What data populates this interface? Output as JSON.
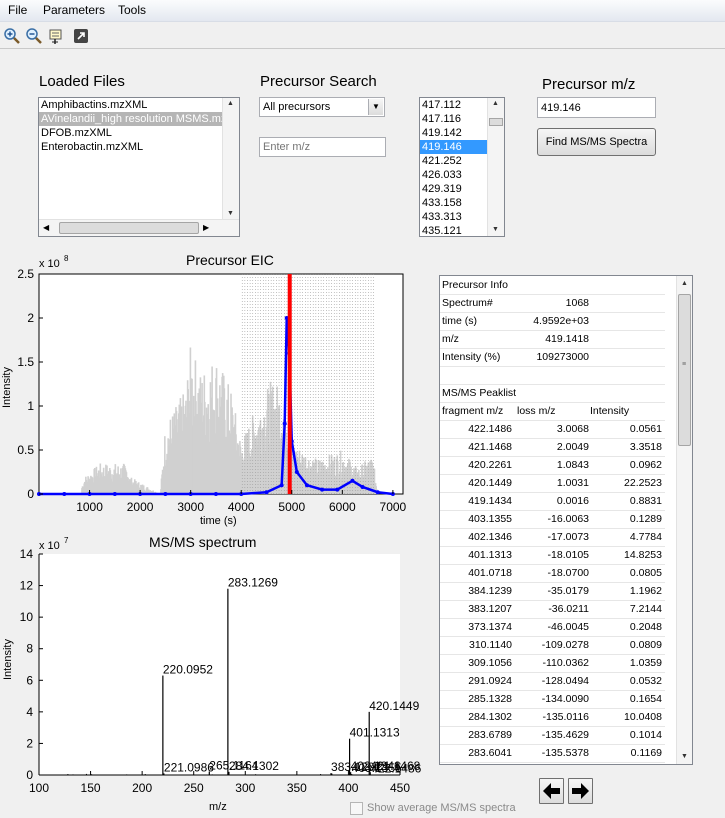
{
  "menu": [
    "File",
    "Parameters",
    "Tools"
  ],
  "toolbar_icons": [
    "zoom-in-icon",
    "zoom-out-icon",
    "data-cursor-icon",
    "export-icon"
  ],
  "loaded_files": {
    "title": "Loaded Files",
    "items": [
      "Amphibactins.mzXML",
      "AVinelandii_high resolution MSMS.mzXML",
      "DFOB.mzXML",
      "Enterobactin.mzXML"
    ],
    "selected_index": 1
  },
  "precursor_search": {
    "title": "Precursor Search",
    "dropdown_value": "All precursors",
    "mz_placeholder": "Enter m/z",
    "list": [
      "417.112",
      "417.116",
      "419.142",
      "419.146",
      "421.252",
      "426.033",
      "429.319",
      "433.158",
      "433.313",
      "435.121"
    ],
    "selected_index": 3
  },
  "precursor_mz": {
    "title": "Precursor m/z",
    "value": "419.146",
    "button_label": "Find MS/MS Spectra"
  },
  "eic_chart": {
    "title": "Precursor EIC",
    "xlabel": "time (s)",
    "ylabel": "Intensity",
    "exponent_base": "x 10",
    "exponent_power": "8",
    "yticks": [
      "0",
      "0.5",
      "1",
      "1.5",
      "2",
      "2.5"
    ],
    "xticks": [
      "1000",
      "2000",
      "3000",
      "4000",
      "5000",
      "6000",
      "7000"
    ]
  },
  "msms_chart": {
    "title": "MS/MS spectrum",
    "xlabel": "m/z",
    "ylabel": "Intensity",
    "exponent_base": "x 10",
    "exponent_power": "7",
    "yticks": [
      "0",
      "2",
      "4",
      "6",
      "8",
      "10",
      "12",
      "14"
    ],
    "xticks": [
      "100",
      "150",
      "200",
      "250",
      "300",
      "350",
      "400",
      "450"
    ],
    "peak_labels": [
      "283.1269",
      "220.0952",
      "221.0986",
      "265.1164",
      "284.1302",
      "383.1207",
      "401.1313",
      "402.1346",
      "403.1355",
      "420.1449",
      "421.1468",
      "422.1486"
    ]
  },
  "chart_data": [
    {
      "type": "line",
      "title": "Precursor EIC",
      "xlabel": "time (s)",
      "ylabel": "Intensity",
      "xlim": [
        0,
        7200
      ],
      "ylim": [
        0,
        250000000
      ],
      "series": [
        {
          "color": "#0000ff",
          "x": [
            0,
            500,
            1000,
            1500,
            2000,
            2500,
            3000,
            3500,
            4000,
            4500,
            4800,
            4860,
            4900,
            4950,
            5000,
            5100,
            5300,
            5600,
            5900,
            6200,
            6400,
            6700,
            7000
          ],
          "y": [
            0,
            0,
            0,
            0,
            0,
            0,
            0,
            0,
            0,
            2000000,
            10000000,
            80000000,
            200000000,
            160000000,
            60000000,
            25000000,
            10000000,
            5000000,
            5000000,
            15000000,
            8000000,
            2000000,
            0
          ]
        },
        {
          "color": "#d0d0d0",
          "x": [
            0,
            800,
            900,
            1200,
            1750,
            1800,
            2400,
            2500,
            2900,
            3000,
            3200,
            3500,
            3800,
            4000,
            4300,
            4600,
            4900,
            5000,
            5500,
            6000,
            6300,
            6600,
            6700
          ],
          "y": [
            0,
            0,
            20000000,
            35000000,
            35000000,
            20000000,
            0,
            80000000,
            120000000,
            170000000,
            140000000,
            160000000,
            120000000,
            60000000,
            100000000,
            130000000,
            120000000,
            60000000,
            40000000,
            50000000,
            30000000,
            45000000,
            0
          ]
        }
      ],
      "marker_x": 4959.2,
      "marker_color": "#ff0000"
    },
    {
      "type": "bar",
      "title": "MS/MS spectrum",
      "xlabel": "m/z",
      "ylabel": "Intensity",
      "xlim": [
        100,
        450
      ],
      "ylim": [
        0,
        140000000
      ],
      "x": [
        220.0952,
        221.0986,
        265.1164,
        283.1269,
        284.1302,
        383.1207,
        401.1313,
        402.1346,
        403.1355,
        420.1449,
        421.1468,
        422.1486
      ],
      "y": [
        63000000,
        1000000,
        2200000,
        118000000,
        2000000,
        1200000,
        23000000,
        1800000,
        600000,
        40000000,
        1800000,
        200000
      ]
    }
  ],
  "peak_table": {
    "precursor_info_label": "Precursor Info",
    "info_rows": [
      {
        "key": "Spectrum#",
        "value": "1068"
      },
      {
        "key": "time (s)",
        "value": "4.9592e+03"
      },
      {
        "key": "m/z",
        "value": "419.1418"
      },
      {
        "key": "Intensity (%)",
        "value": "109273000"
      }
    ],
    "peaklist_label": "MS/MS Peaklist",
    "columns": [
      "fragment m/z",
      "loss m/z",
      "Intensity"
    ],
    "rows": [
      [
        "422.1486",
        "3.0068",
        "0.0561"
      ],
      [
        "421.1468",
        "2.0049",
        "3.3518"
      ],
      [
        "420.2261",
        "1.0843",
        "0.0962"
      ],
      [
        "420.1449",
        "1.0031",
        "22.2523"
      ],
      [
        "419.1434",
        "0.0016",
        "0.8831"
      ],
      [
        "403.1355",
        "-16.0063",
        "0.1289"
      ],
      [
        "402.1346",
        "-17.0073",
        "4.7784"
      ],
      [
        "401.1313",
        "-18.0105",
        "14.8253"
      ],
      [
        "401.0718",
        "-18.0700",
        "0.0805"
      ],
      [
        "384.1239",
        "-35.0179",
        "1.1962"
      ],
      [
        "383.1207",
        "-36.0211",
        "7.2144"
      ],
      [
        "373.1374",
        "-46.0045",
        "0.2048"
      ],
      [
        "310.1140",
        "-109.0278",
        "0.0809"
      ],
      [
        "309.1056",
        "-110.0362",
        "1.0359"
      ],
      [
        "291.0924",
        "-128.0494",
        "0.0532"
      ],
      [
        "285.1328",
        "-134.0090",
        "0.1654"
      ],
      [
        "284.1302",
        "-135.0116",
        "10.0408"
      ],
      [
        "283.6789",
        "-135.4629",
        "0.1014"
      ],
      [
        "283.6041",
        "-135.5378",
        "0.1169"
      ]
    ]
  },
  "show_average_label": "Show average MS/MS spectra"
}
